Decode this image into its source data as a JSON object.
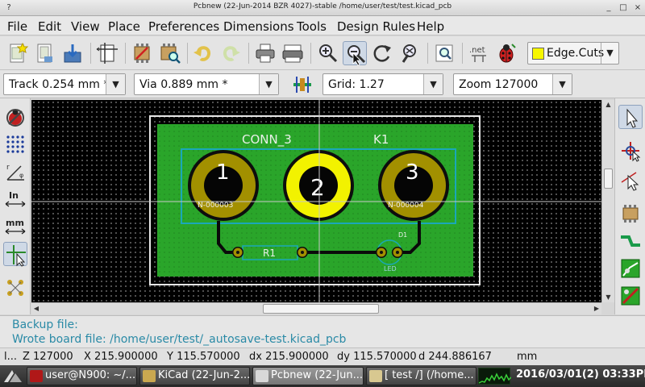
{
  "window": {
    "title": "Pcbnew (22-Jun-2014 BZR 4027)-stable /home/user/test/test.kicad_pcb",
    "controls": [
      "?",
      "_",
      "□",
      "×"
    ]
  },
  "menu": [
    "File",
    "Edit",
    "View",
    "Place",
    "Preferences",
    "Dimensions",
    "Tools",
    "Design Rules",
    "Help"
  ],
  "toolbar": {
    "buttons": [
      "new-board",
      "open-board",
      "save-board",
      "page-settings",
      "module-editor",
      "module-viewer",
      "undo",
      "redo",
      "print",
      "plot",
      "zoom-in",
      "zoom-out",
      "zoom-redraw",
      "zoom-auto",
      "find",
      "netlist",
      "drc"
    ],
    "netlist_label": ".net",
    "active_layer": {
      "label": "Edge.Cuts",
      "color": "#f7f700"
    }
  },
  "toolbar2": {
    "track": "Track 0.254 mm *",
    "via": "Via 0.889 mm *",
    "grid": "Grid: 1.27",
    "zoom": "Zoom 127000"
  },
  "left_toolbar": [
    "drc-off",
    "grid-toggle",
    "polar-coords",
    "inch-units",
    "mm-units",
    "cursor-shape",
    "show-ratsnest"
  ],
  "left_toolbar_labels": {
    "inch": "In",
    "mm": "mm"
  },
  "right_toolbar": [
    "select",
    "highlight-net",
    "local-ratsnest",
    "add-module",
    "add-track",
    "add-zone",
    "microwave"
  ],
  "board": {
    "module_value": "CONN_3",
    "module_ref": "K1",
    "pads": [
      {
        "number": "1",
        "net": "N-000003"
      },
      {
        "number": "2",
        "net": ""
      },
      {
        "number": "3",
        "net": "N-000004"
      }
    ],
    "resistor_ref": "R1",
    "led_ref": "D1",
    "led_value": "LED",
    "colors": {
      "copper": "#2aa52a",
      "pad_front": "#a29000",
      "pad_selected": "#f2f200",
      "edge": "#eaeaea",
      "silk": "#00d0d0"
    }
  },
  "messages": [
    "Backup file:",
    "Wrote board file: /home/user/test/_autosave-test.kicad_pcb"
  ],
  "status": {
    "clip": "l...",
    "z": "Z 127000",
    "x": "X 215.900000",
    "y": "Y 115.570000",
    "dx": "dx 215.900000",
    "dy": "dy 115.570000",
    "d": "d 244.886167",
    "units": "mm"
  },
  "taskbar": {
    "tasks": [
      {
        "label": "user@N900: ~/...",
        "active": false
      },
      {
        "label": "KiCad (22-Jun-2...",
        "active": false
      },
      {
        "label": "Pcbnew (22-Jun...",
        "active": true
      },
      {
        "label": "[ test /] (/home...",
        "active": false
      }
    ],
    "clock": "2016/03/01(2) 03:33PM"
  }
}
